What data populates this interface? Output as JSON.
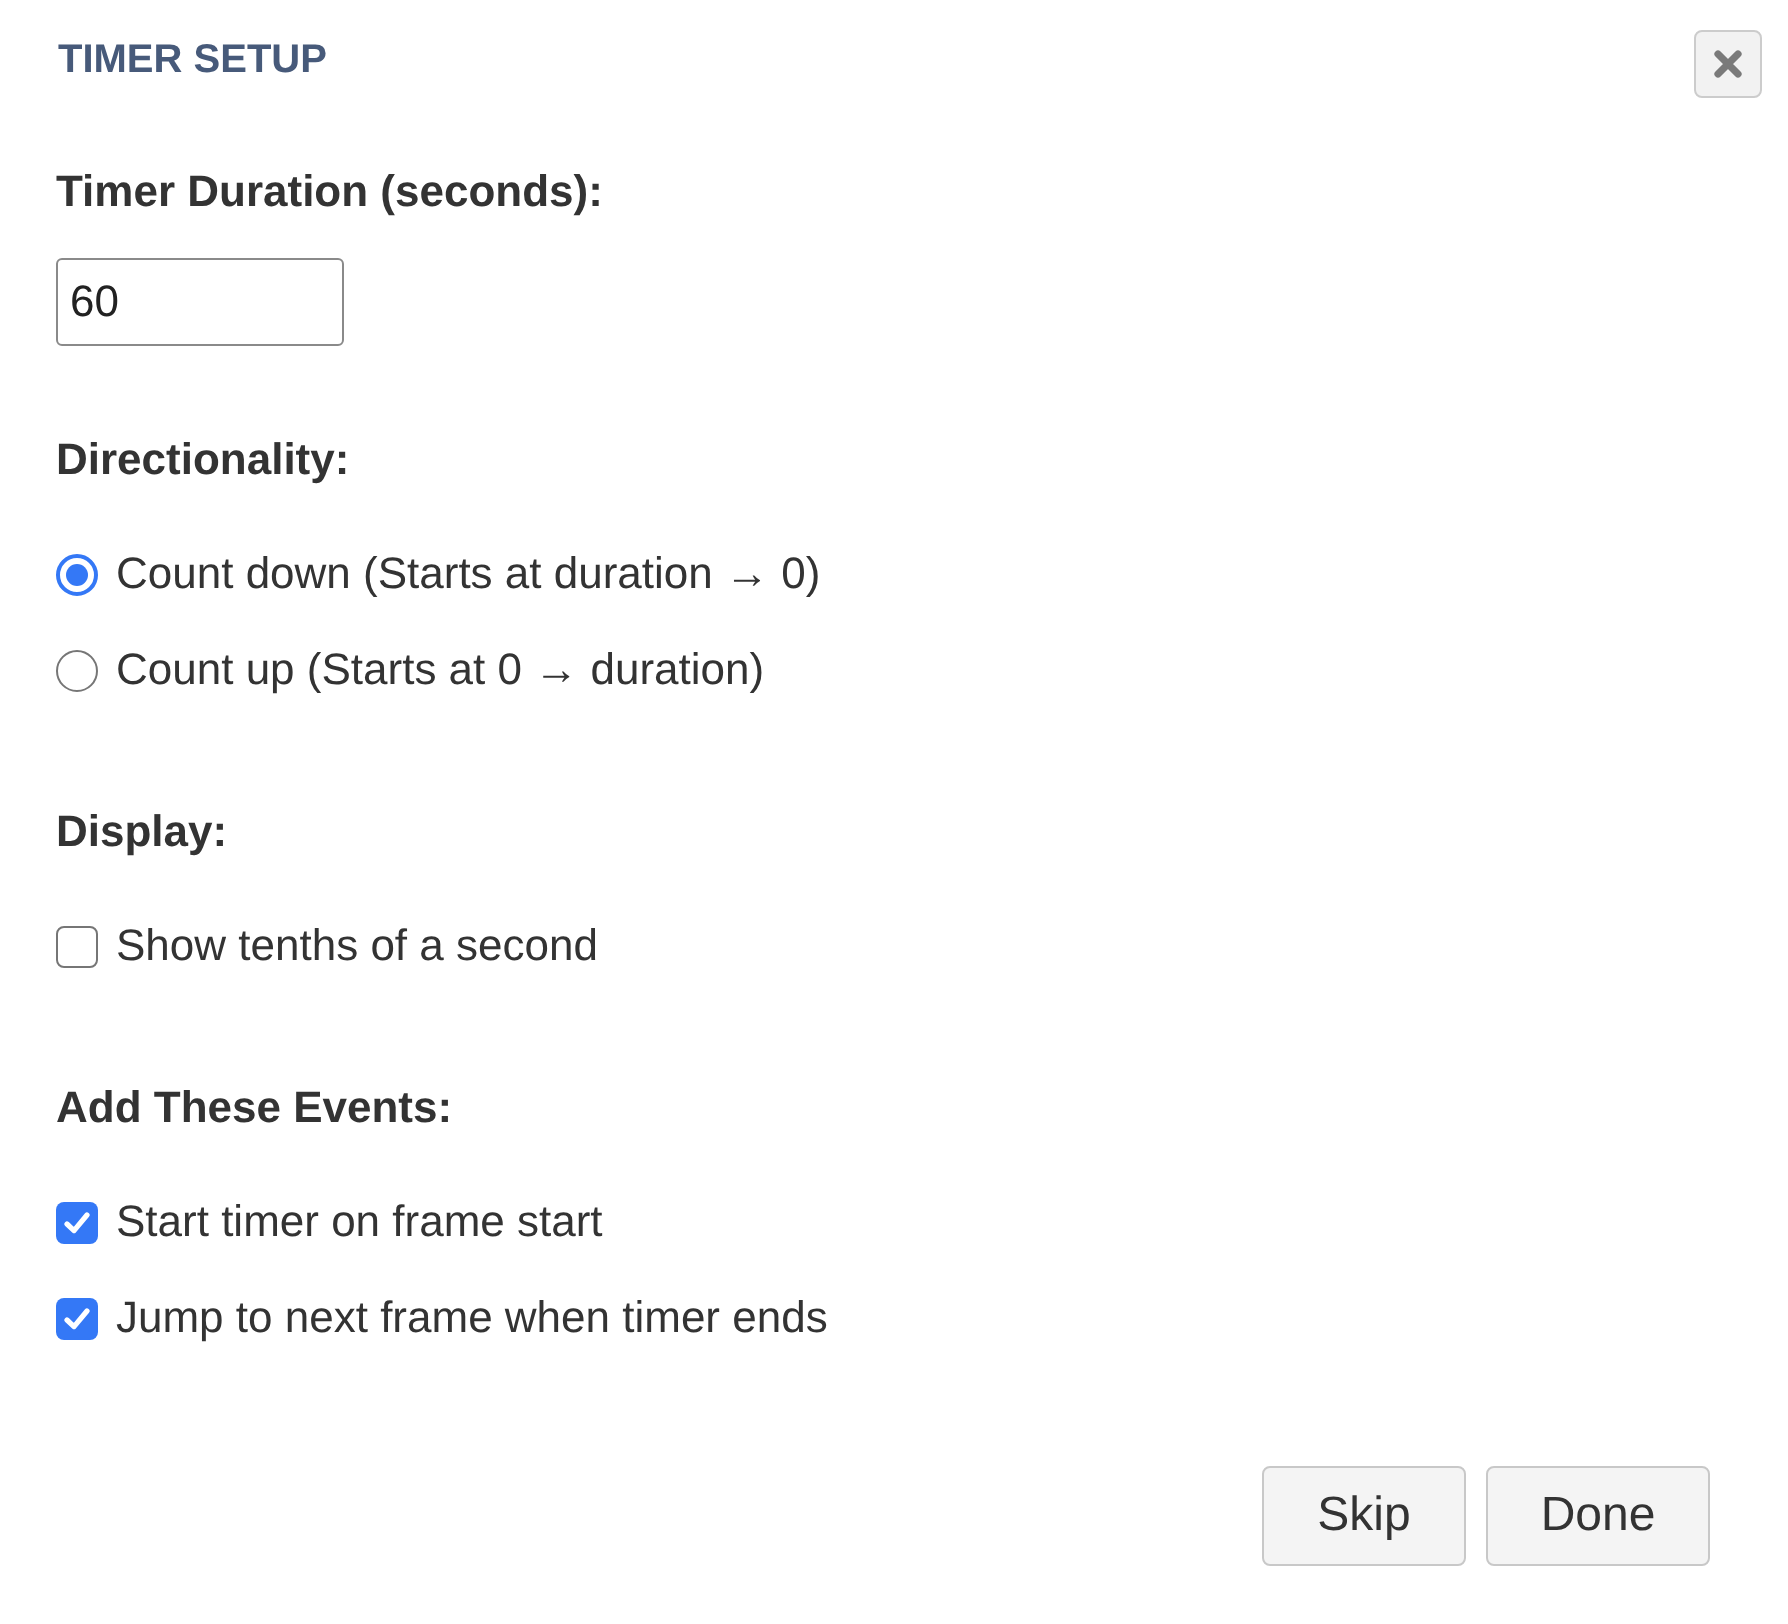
{
  "title": "TIMER SETUP",
  "sections": [
    {
      "kind": "number",
      "label": "Timer Duration (seconds):",
      "value": "60"
    },
    {
      "kind": "radio",
      "label": "Directionality:",
      "options": [
        {
          "label": "Count down (Starts at duration → 0)",
          "selected": true
        },
        {
          "label": "Count up (Starts at 0 → duration)",
          "selected": false
        }
      ]
    },
    {
      "kind": "checkbox",
      "label": "Display:",
      "options": [
        {
          "label": "Show tenths of a second",
          "checked": false
        }
      ]
    },
    {
      "kind": "checkbox",
      "label": "Add These Events:",
      "options": [
        {
          "label": "Start timer on frame start",
          "checked": true
        },
        {
          "label": "Jump to next frame when timer ends",
          "checked": true
        }
      ]
    }
  ],
  "buttons": [
    "Skip",
    "Done"
  ]
}
